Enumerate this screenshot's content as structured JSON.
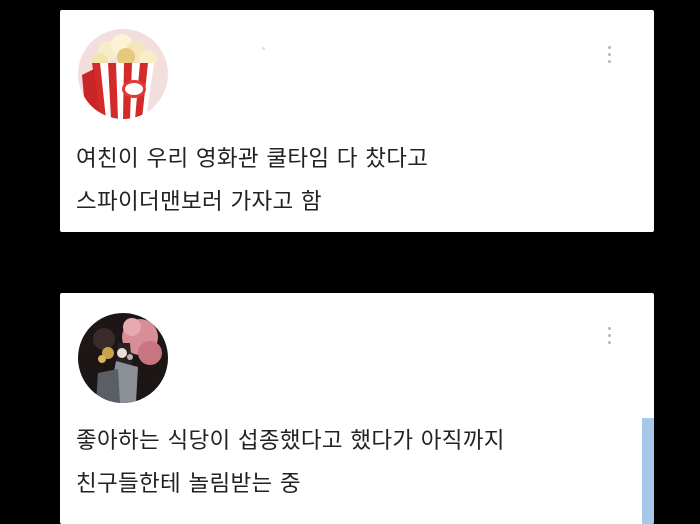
{
  "posts": [
    {
      "avatar_icon": "popcorn-avatar-icon",
      "more_icon": "more-vertical-icon",
      "lines": [
        "여친이 우리 영화관 쿨타임 다 찼다고",
        "스파이더맨보러 가자고 함"
      ]
    },
    {
      "avatar_icon": "character-avatar-icon",
      "more_icon": "more-vertical-icon",
      "lines": [
        "좋아하는 식당이 섭종했다고 했다가 아직까지",
        "친구들한테 놀림받는 중"
      ]
    }
  ],
  "colors": {
    "background": "#000000",
    "card": "#ffffff",
    "text": "#222222",
    "accent_bar": "#a8c8ea"
  }
}
